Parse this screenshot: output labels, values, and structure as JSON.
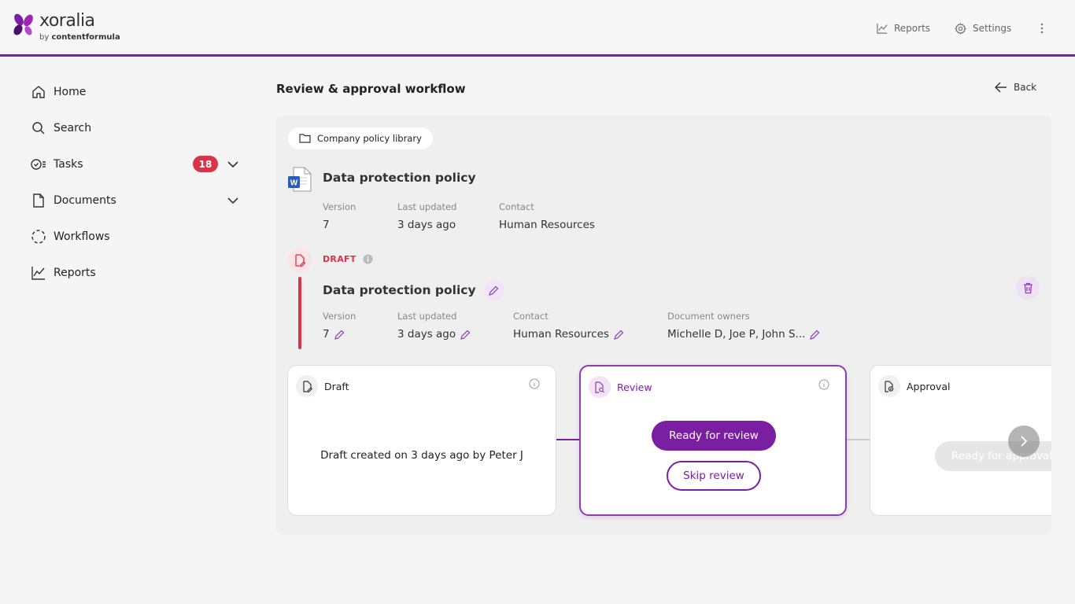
{
  "brand": {
    "name": "xoralia",
    "sub_prefix": "by ",
    "sub_name": "contentformula"
  },
  "topnav": {
    "reports": "Reports",
    "settings": "Settings"
  },
  "sidebar": {
    "items": [
      {
        "label": "Home"
      },
      {
        "label": "Search"
      },
      {
        "label": "Tasks",
        "badge": "18"
      },
      {
        "label": "Documents"
      },
      {
        "label": "Workflows"
      },
      {
        "label": "Reports"
      }
    ]
  },
  "page": {
    "title": "Review & approval workflow",
    "back": "Back"
  },
  "library": {
    "label": "Company policy library"
  },
  "document": {
    "title": "Data protection policy",
    "version_label": "Version",
    "version": "7",
    "updated_label": "Last updated",
    "updated": "3 days ago",
    "contact_label": "Contact",
    "contact": "Human Resources"
  },
  "draft": {
    "status": "DRAFT",
    "title": "Data protection policy",
    "version_label": "Version",
    "version": "7",
    "updated_label": "Last updated",
    "updated": "3 days ago",
    "contact_label": "Contact",
    "contact": "Human Resources",
    "owners_label": "Document owners",
    "owners": "Michelle D, Joe P, John S..."
  },
  "stages": {
    "draft": {
      "title": "Draft",
      "message": "Draft created on 3 days ago by Peter J"
    },
    "review": {
      "title": "Review",
      "primary": "Ready for review",
      "secondary": "Skip review"
    },
    "approval": {
      "title": "Approval",
      "primary": "Ready for approval"
    }
  },
  "colors": {
    "accent": "#7b1fa2",
    "danger": "#d93448"
  }
}
